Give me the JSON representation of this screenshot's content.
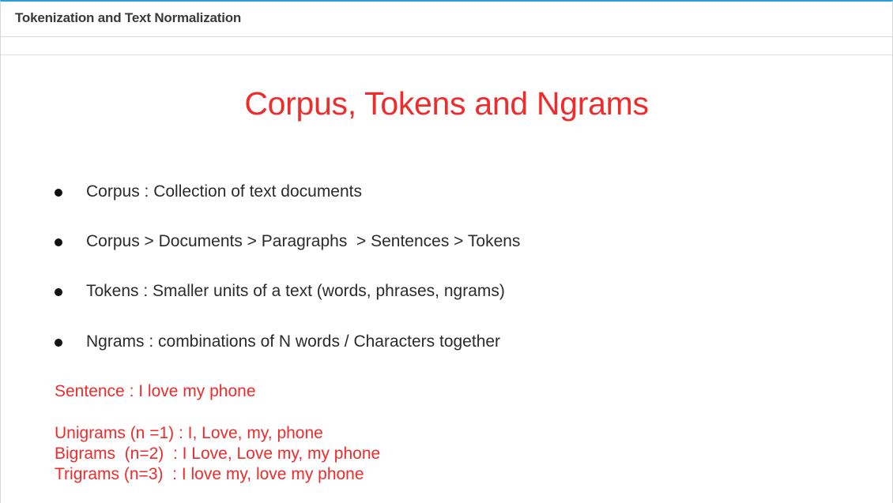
{
  "header": {
    "title": "Tokenization and Text Normalization"
  },
  "slide": {
    "title": "Corpus, Tokens and Ngrams",
    "bullets": [
      "Corpus : Collection of text documents",
      "Corpus > Documents > Paragraphs  > Sentences > Tokens",
      "Tokens : Smaller units of a text (words, phrases, ngrams)",
      "Ngrams : combinations of N words / Characters together"
    ],
    "sentence": "Sentence : I love my phone",
    "ngram_examples": [
      "Unigrams (n =1) : I, Love, my, phone",
      "Bigrams  (n=2)  : I Love, Love my, my phone",
      "Trigrams (n=3)  : I love my, love my phone"
    ]
  },
  "colors": {
    "accent_red": "#ef2b2b",
    "top_border": "#2a9fd6",
    "text_dark": "#2b2b2b"
  }
}
